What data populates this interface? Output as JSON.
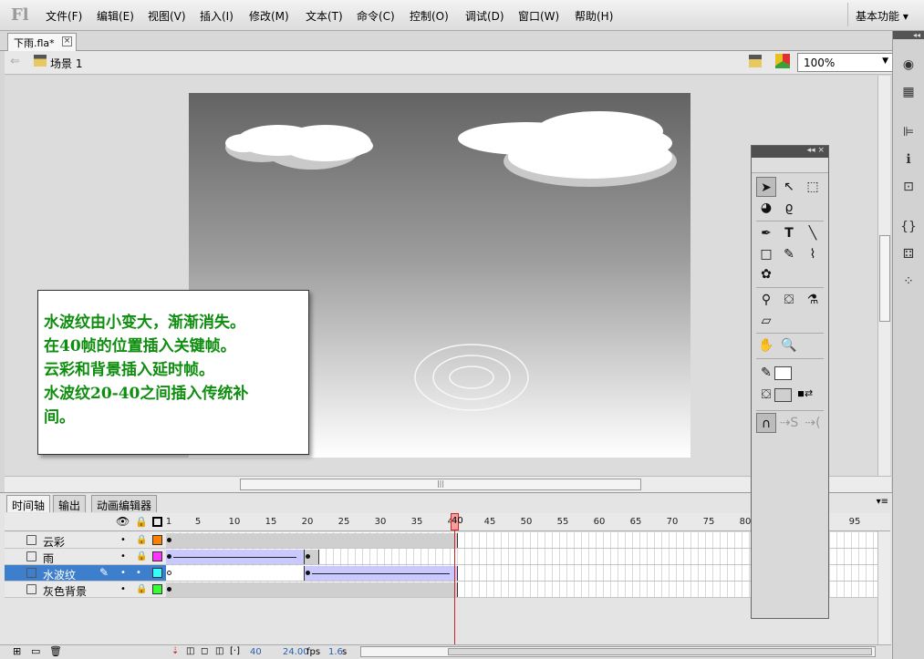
{
  "app": {
    "logo": "Fl",
    "menus": [
      "文件(F)",
      "编辑(E)",
      "视图(V)",
      "插入(I)",
      "修改(M)",
      "文本(T)",
      "命令(C)",
      "控制(O)",
      "调试(D)",
      "窗口(W)",
      "帮助(H)"
    ],
    "workspace": "基本功能 ▾"
  },
  "document": {
    "tab": "下雨.fla*",
    "scene": "场景 1",
    "zoom": "100%"
  },
  "stage": {
    "note_lines": [
      "水波纹由小变大，渐渐消失。",
      "在40帧的位置插入关键帧。",
      "云彩和背景插入延时帧。",
      "水波纹20-40之间插入传统补",
      "间。"
    ]
  },
  "panel_tabs": [
    "时间轴",
    "输出",
    "动画编辑器"
  ],
  "timeline": {
    "ruler": [
      "1",
      "5",
      "10",
      "15",
      "20",
      "25",
      "30",
      "35",
      "40",
      "45",
      "50",
      "55",
      "60",
      "65",
      "70",
      "75",
      "80",
      "95"
    ],
    "layers": [
      {
        "name": "云彩",
        "color": "#ff7f00"
      },
      {
        "name": "雨",
        "color": "#ff33ff"
      },
      {
        "name": "水波纹",
        "color": "#33ffff"
      },
      {
        "name": "灰色背景",
        "color": "#33ff33"
      }
    ],
    "current_frame": "40",
    "fps": "24.00",
    "fps_unit": "fps",
    "time": "1.6",
    "time_unit": "s"
  },
  "icons": {
    "tools": [
      "arrow-icon",
      "subselect-icon",
      "free-transform-icon",
      "3d-rotation-icon",
      "lasso-icon",
      "pen-icon",
      "text-icon",
      "line-icon",
      "rectangle-icon",
      "pencil-icon",
      "brush-icon",
      "deco-icon",
      "bone-icon",
      "paint-bucket-icon",
      "eyedropper-icon",
      "eraser-icon",
      "hand-icon",
      "zoom-icon"
    ]
  }
}
